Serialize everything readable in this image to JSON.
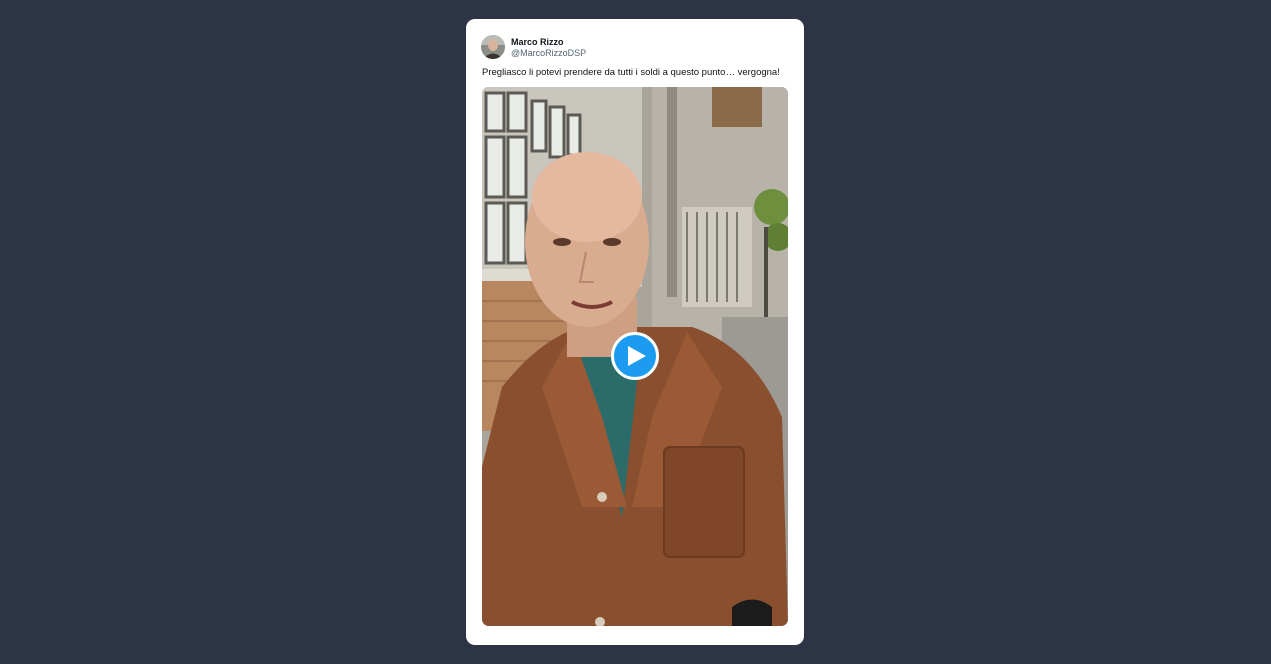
{
  "tweet": {
    "author": {
      "name": "Marco Rizzo",
      "handle": "@MarcoRizzoDSP"
    },
    "text": "Pregliasco li potevi prendere da tutti i soldi a questo punto… vergogna!",
    "media": {
      "type": "video",
      "play_icon": "play-icon"
    }
  },
  "colors": {
    "page_background": "#2d3446",
    "card_background": "#ffffff",
    "play_accent": "#1d9bf0",
    "handle_text": "#536471"
  }
}
